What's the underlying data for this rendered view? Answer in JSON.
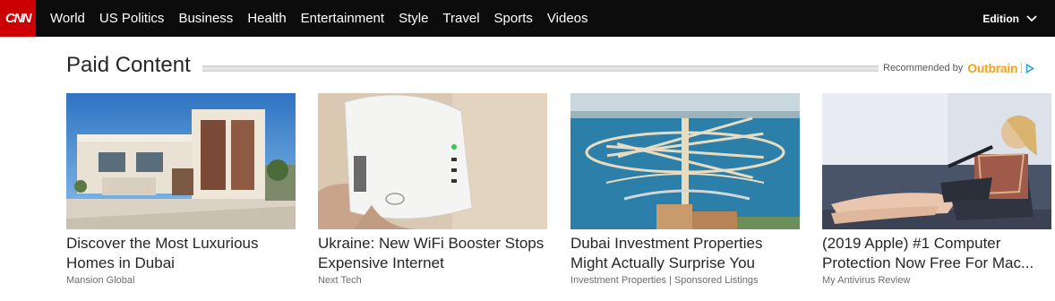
{
  "nav": {
    "logo": "CNN",
    "items": [
      "World",
      "US Politics",
      "Business",
      "Health",
      "Entertainment",
      "Style",
      "Travel",
      "Sports",
      "Videos"
    ],
    "edition_label": "Edition"
  },
  "section": {
    "title": "Paid Content",
    "recommended_by": "Recommended by",
    "provider": "Outbrain"
  },
  "cards": [
    {
      "headline": "Discover the Most Luxurious Homes in Dubai",
      "source": "Mansion Global"
    },
    {
      "headline": "Ukraine: New WiFi Booster Stops Expensive Internet",
      "source": "Next Tech"
    },
    {
      "headline": "Dubai Investment Properties Might Actually Surprise You",
      "source": "Investment Properties | Sponsored Listings"
    },
    {
      "headline": "(2019 Apple) #1 Computer Protection Now Free For Mac...",
      "source": "My Antivirus Review"
    }
  ],
  "colors": {
    "brand_red": "#cc0000",
    "nav_bg": "#0c0c0c",
    "outbrain_orange": "#f6a11a",
    "adchoices_blue": "#1fa3e0"
  },
  "icons": [
    "chevron-down-icon",
    "adchoices-icon"
  ]
}
